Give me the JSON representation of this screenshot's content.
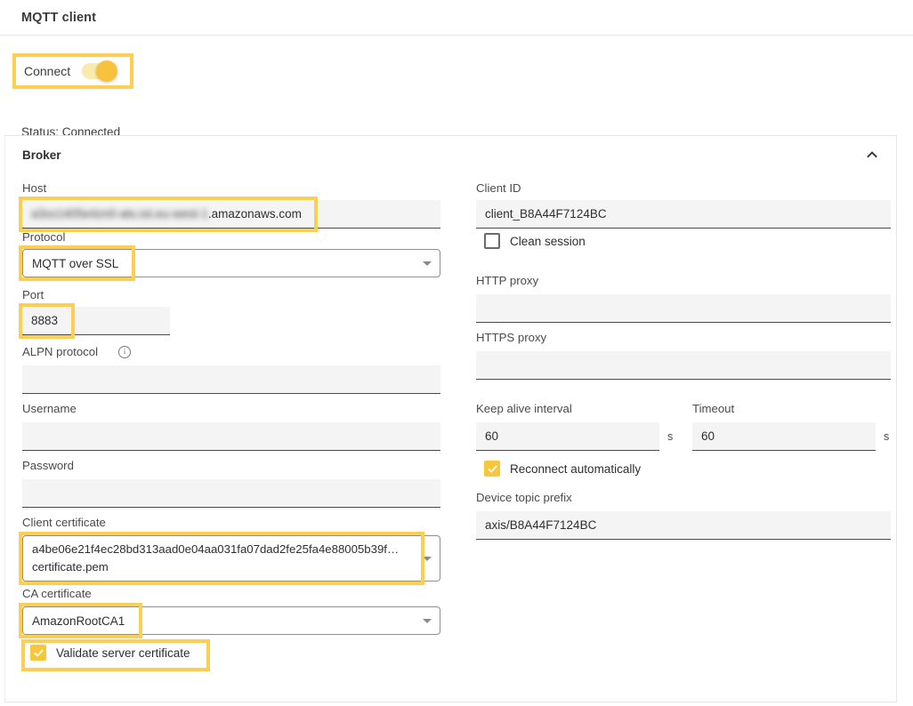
{
  "header": {
    "title": "MQTT client"
  },
  "connect": {
    "label": "Connect",
    "toggle_state": "on",
    "status": "Status: Connected"
  },
  "broker": {
    "title": "Broker",
    "collapse_icon": "chevron-up-icon",
    "left": {
      "host": {
        "label": "Host",
        "redacted_value": "a3xx1405e4zn0-ats.iot.eu-west-1",
        "visible_suffix": ".amazonaws.com"
      },
      "protocol": {
        "label": "Protocol",
        "value": "MQTT over SSL"
      },
      "port": {
        "label": "Port",
        "value": "8883"
      },
      "alpn": {
        "label": "ALPN protocol",
        "value": "",
        "info_icon": "info-circle-icon"
      },
      "username": {
        "label": "Username",
        "value": ""
      },
      "password": {
        "label": "Password",
        "value": ""
      },
      "client_certificate": {
        "label": "Client certificate",
        "value_line1": "a4be06e21f4ec28bd313aad0e04aa031fa07dad2fe25fa4e88005b39f…",
        "value_line2": "certificate.pem"
      },
      "ca_certificate": {
        "label": "CA certificate",
        "value": "AmazonRootCA1"
      },
      "validate_server_certificate": {
        "label": "Validate server certificate",
        "checked": true
      }
    },
    "right": {
      "client_id": {
        "label": "Client ID",
        "value": "client_B8A44F7124BC"
      },
      "clean_session": {
        "label": "Clean session",
        "checked": false
      },
      "http_proxy": {
        "label": "HTTP proxy",
        "value": ""
      },
      "https_proxy": {
        "label": "HTTPS proxy",
        "value": ""
      },
      "keep_alive": {
        "label": "Keep alive interval",
        "value": "60",
        "unit": "s"
      },
      "timeout": {
        "label": "Timeout",
        "value": "60",
        "unit": "s"
      },
      "reconnect_automatically": {
        "label": "Reconnect automatically",
        "checked": true
      },
      "device_topic_prefix": {
        "label": "Device topic prefix",
        "value": "axis/B8A44F7124BC"
      }
    }
  },
  "colors": {
    "highlight": "#FBCF51",
    "accent": "#F8C33C",
    "field_bg": "#F4F4F4",
    "text": "#333333"
  }
}
